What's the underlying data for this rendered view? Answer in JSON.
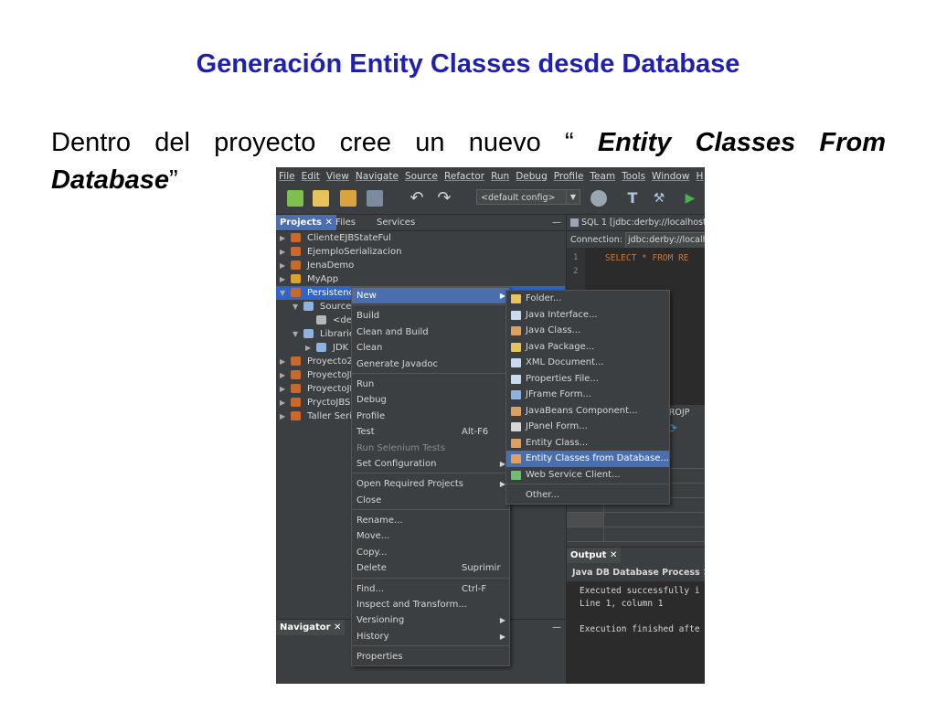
{
  "slide": {
    "title": "Generación  Entity Classes desde Database",
    "body_line1_prefix": "Dentro del proyecto cree un nuevo “",
    "body_line1_italic": "Entity Classes From",
    "body_line2_italic": "Database",
    "body_line2_suffix": "”"
  },
  "ide": {
    "menubar": [
      "File",
      "Edit",
      "View",
      "Navigate",
      "Source",
      "Refactor",
      "Run",
      "Debug",
      "Profile",
      "Team",
      "Tools",
      "Window",
      "H"
    ],
    "config_combo": "<default config>",
    "left_tabs": {
      "projects": "Projects",
      "files": "Files",
      "services": "Services",
      "close": "✕",
      "minimize": "—"
    },
    "projects": [
      {
        "label": "ClienteEJBStateFul",
        "level": 0
      },
      {
        "label": "EjemploSerializacion",
        "level": 0
      },
      {
        "label": "JenaDemo",
        "level": 0
      },
      {
        "label": "MyApp",
        "level": 0
      },
      {
        "label": "Persistencia",
        "level": 0
      },
      {
        "label": "Source P",
        "level": 1
      },
      {
        "label": "<defaul",
        "level": 2
      },
      {
        "label": "Libraries",
        "level": 1
      },
      {
        "label": "JDK 1.8",
        "level": 2
      },
      {
        "label": "Proyecto2",
        "level": 0
      },
      {
        "label": "ProyectoJE",
        "level": 0
      },
      {
        "label": "ProyectoJE",
        "level": 0
      },
      {
        "label": "PryctoJBS",
        "level": 0
      },
      {
        "label": "Taller Seri",
        "level": 0
      }
    ],
    "navigator_tab": "Navigator",
    "editor_tab": "SQL 1 [jdbc:derby://localhost:",
    "connection_label": "Connection:",
    "connection_value": "jdbc:derby://localho",
    "code_line": "SELECT * FROM RE",
    "line_numbers": [
      "1",
      "2"
    ],
    "result_tab": "STROJP",
    "output_tab": "Output",
    "output_subtab": "Java DB Database Process",
    "output_lines": [
      "Executed successfully i",
      "Line 1, column 1",
      "",
      "Execution finished afte"
    ],
    "context_menu": [
      {
        "label": "New",
        "submenu": true,
        "selected": true
      },
      {
        "sep": true
      },
      {
        "label": "Build"
      },
      {
        "label": "Clean and Build"
      },
      {
        "label": "Clean"
      },
      {
        "label": "Generate Javadoc"
      },
      {
        "sep": true
      },
      {
        "label": "Run"
      },
      {
        "label": "Debug"
      },
      {
        "label": "Profile"
      },
      {
        "label": "Test",
        "shortcut": "Alt-F6"
      },
      {
        "label": "Run Selenium Tests",
        "disabled": true
      },
      {
        "label": "Set Configuration",
        "submenu": true
      },
      {
        "sep": true
      },
      {
        "label": "Open Required Projects",
        "submenu": true
      },
      {
        "label": "Close"
      },
      {
        "sep": true
      },
      {
        "label": "Rename..."
      },
      {
        "label": "Move..."
      },
      {
        "label": "Copy..."
      },
      {
        "label": "Delete",
        "shortcut": "Suprimir"
      },
      {
        "sep": true
      },
      {
        "label": "Find...",
        "shortcut": "Ctrl-F"
      },
      {
        "label": "Inspect and Transform..."
      },
      {
        "label": "Versioning",
        "submenu": true
      },
      {
        "label": "History",
        "submenu": true
      },
      {
        "sep": true
      },
      {
        "label": "Properties"
      }
    ],
    "new_submenu": [
      {
        "label": "Folder...",
        "icon": "folder-icon",
        "color": "#e8c25a"
      },
      {
        "label": "Java Interface...",
        "icon": "java-interface-icon",
        "color": "#c9d9f0"
      },
      {
        "label": "Java Class...",
        "icon": "java-class-icon",
        "color": "#e0a060"
      },
      {
        "label": "Java Package...",
        "icon": "java-package-icon",
        "color": "#e8c25a"
      },
      {
        "label": "XML Document...",
        "icon": "xml-document-icon",
        "color": "#c9d9f0"
      },
      {
        "label": "Properties File...",
        "icon": "properties-file-icon",
        "color": "#c9d9f0"
      },
      {
        "label": "JFrame Form...",
        "icon": "jframe-form-icon",
        "color": "#8fb3e0"
      },
      {
        "label": "JavaBeans Component...",
        "icon": "javabeans-icon",
        "color": "#e0a060"
      },
      {
        "label": "JPanel Form...",
        "icon": "jpanel-form-icon",
        "color": "#d8d8d8"
      },
      {
        "label": "Entity Class...",
        "icon": "entity-class-icon",
        "color": "#e0a060"
      },
      {
        "label": "Entity Classes from Database...",
        "icon": "entity-db-icon",
        "color": "#e0a060",
        "selected": true
      },
      {
        "label": "Web Service Client...",
        "icon": "web-service-icon",
        "color": "#6cc070"
      },
      {
        "sep": true
      },
      {
        "label": "Other...",
        "icon": "",
        "color": ""
      }
    ]
  }
}
